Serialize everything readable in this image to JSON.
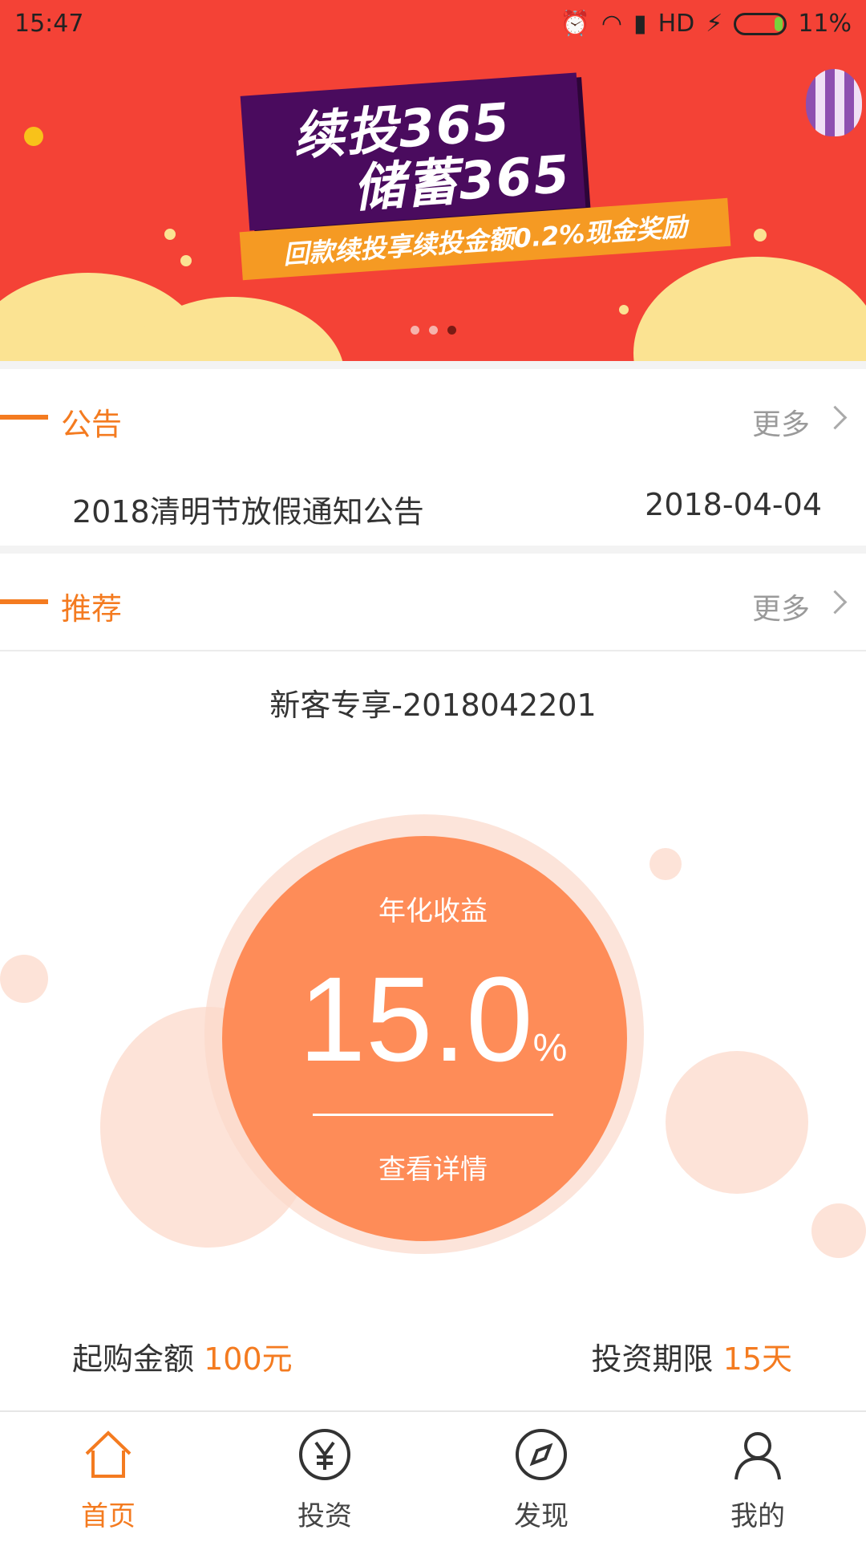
{
  "status_bar": {
    "time": "15:47",
    "network": "HD",
    "battery": "11%"
  },
  "banner": {
    "line1": "续投365",
    "line2": "储蓄365",
    "ribbon": "回款续投享续投金额0.2%现金奖励",
    "active_page": 3,
    "pages": 3
  },
  "notice": {
    "title": "公告",
    "more": "更多",
    "item_text": "2018清明节放假通知公告",
    "item_date": "2018-04-04"
  },
  "recommend": {
    "title": "推荐",
    "more": "更多",
    "product_name": "新客专享-2018042201",
    "rate_label": "年化收益",
    "rate_value": "15.0",
    "rate_unit": "%",
    "detail_link": "查看详情",
    "min_amount_label": "起购金额",
    "min_amount_value": "100元",
    "term_label": "投资期限",
    "term_value": "15天"
  },
  "tabbar": {
    "items": [
      {
        "label": "首页",
        "icon": "home-icon",
        "active": true
      },
      {
        "label": "投资",
        "icon": "yen-icon",
        "active": false
      },
      {
        "label": "发现",
        "icon": "compass-icon",
        "active": false
      },
      {
        "label": "我的",
        "icon": "user-icon",
        "active": false
      }
    ]
  },
  "colors": {
    "accent": "#f47b20",
    "banner_bg": "#f44236",
    "rate_circle": "#fe8c58"
  }
}
